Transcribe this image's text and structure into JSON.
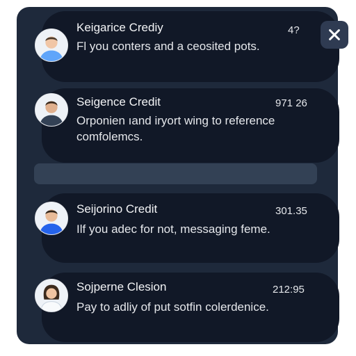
{
  "close_button": {
    "label": "close"
  },
  "notifications": [
    {
      "name": "Keigarice Crediy",
      "time": "4?",
      "message": "Fl you conters and a ceosited pots."
    },
    {
      "name": "Seigence Credit",
      "time": "971 26",
      "message": "Orponien ıand iryort wing to reference comfolemcs."
    },
    {
      "name": "Seijorino Credit",
      "time": "301.35",
      "message": "Ilf you adec for not, messaging feme."
    },
    {
      "name": "Sojperne Clesion",
      "time": "212:95",
      "message": "Pay to adliy of put sotfin colerdenice."
    }
  ]
}
